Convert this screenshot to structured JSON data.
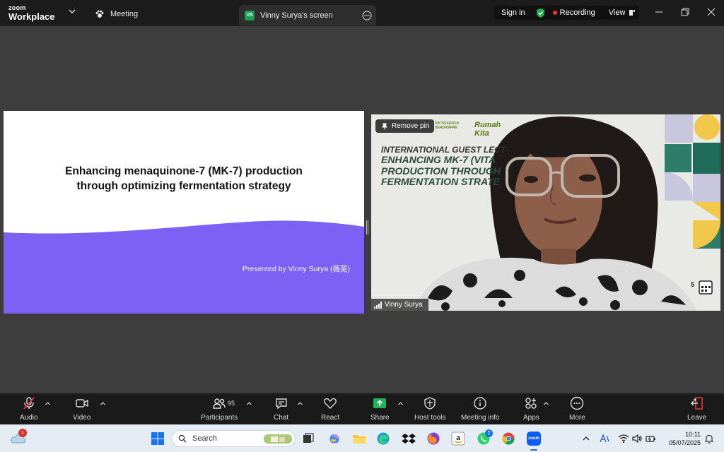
{
  "titlebar": {
    "brand_top": "zoom",
    "brand_bottom": "Workplace",
    "meeting_tab": "Meeting",
    "share_badge": "VS",
    "share_tab": "Vinny Surya's screen",
    "sign_in": "Sign in",
    "recording": "Recording",
    "view": "View",
    "accent_recording": "#e0353b",
    "shield_color": "#1fb054"
  },
  "slide": {
    "title_line1": "Enhancing menaquinone-7 (MK-7) production",
    "title_line2": "through optimizing fermentation strategy",
    "presenter": "Presented by Vinny Surya (薇芜)",
    "wave_color": "#7b62f4"
  },
  "video": {
    "pin_label": "Remove pin",
    "participant_name": "Vinny Surya",
    "logo_text": "DIKTISAINTEK BERDAMPAK",
    "logo_script": "Rumah Kita",
    "banner_line1": "INTERNATIONAL GUEST LECT",
    "banner_line2": "ENHANCING MK-7 (VITA",
    "banner_line3": "PRODUCTION THROUGH",
    "banner_line4": "FERMENTATION STRATE",
    "bg_number": "5"
  },
  "toolbar": {
    "audio": "Audio",
    "video": "Video",
    "participants": "Participants",
    "participants_count": "95",
    "chat": "Chat",
    "react": "React",
    "share": "Share",
    "host_tools": "Host tools",
    "meeting_info": "Meeting info",
    "apps": "Apps",
    "more": "More",
    "leave": "Leave",
    "share_color": "#20b35a",
    "leave_color": "#e0353b"
  },
  "taskbar": {
    "weather_badge": "1",
    "search_placeholder": "Search",
    "whatsapp_badge": "2",
    "zoom_label": "zoom",
    "time": "10:11",
    "date": "05/07/2025"
  }
}
